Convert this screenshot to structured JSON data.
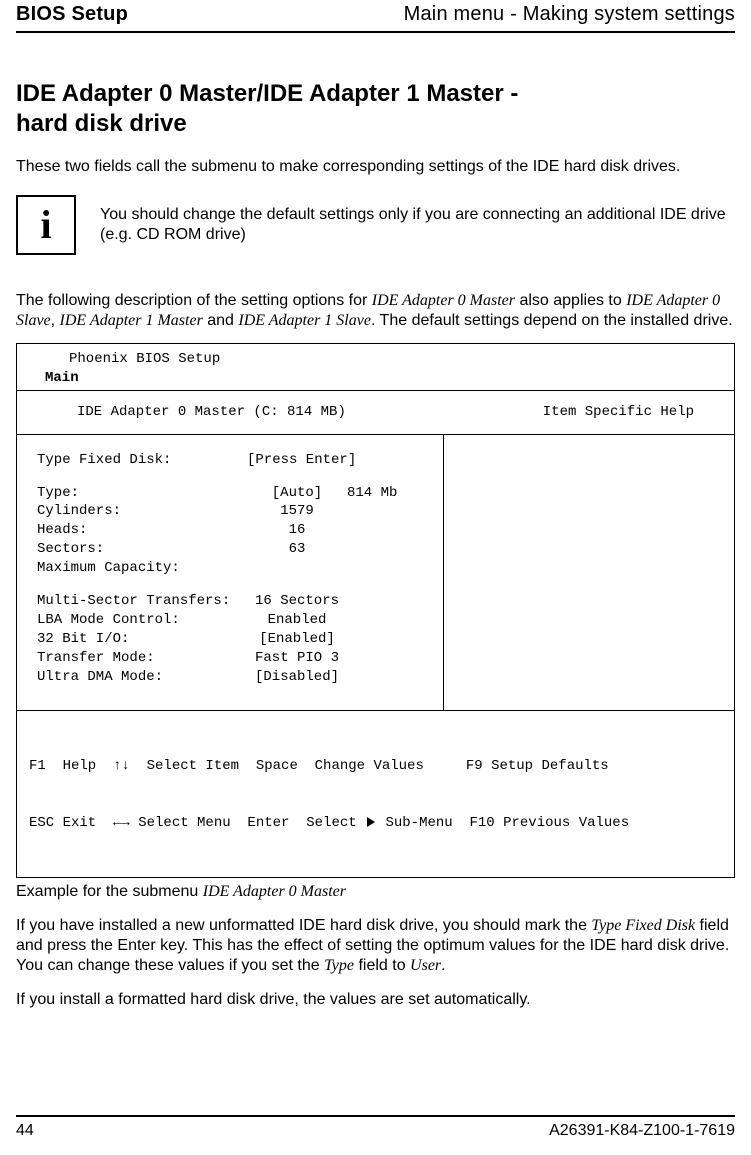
{
  "header": {
    "left": "BIOS Setup",
    "right": "Main menu - Making system settings"
  },
  "section_title_line1": "IDE Adapter 0 Master/IDE Adapter 1 Master -",
  "section_title_line2": "hard disk drive",
  "intro": "These two fields call the submenu to make corresponding settings of the IDE hard disk drives.",
  "info_icon_glyph": "i",
  "info_text": "You should change the default settings only if you are connecting an additional IDE drive (e.g. CD ROM drive)",
  "desc_pre": "The following description of the setting options for ",
  "desc_it1": "IDE Adapter 0 Master",
  "desc_mid1": " also applies to ",
  "desc_it2": "IDE Adapter 0 Slave",
  "desc_mid2": ", ",
  "desc_it3": "IDE Adapter 1 Master",
  "desc_mid3": " and ",
  "desc_it4": "IDE Adapter 1 Slave",
  "desc_post": ". The default settings depend on the installed drive.",
  "bios": {
    "setup_line": "Phoenix BIOS Setup",
    "main": "Main",
    "title_left": "IDE Adapter 0 Master (C: 814 MB)",
    "title_right": "Item Specific Help",
    "rows": {
      "tfd_k": "Type Fixed Disk:",
      "tfd_v": "[Press Enter]",
      "type_k": "Type:",
      "type_v": "[Auto]",
      "type_v2": "814 Mb",
      "cyl_k": "Cylinders:",
      "cyl_v": "1579",
      "heads_k": "Heads:",
      "heads_v": "16",
      "sect_k": "Sectors:",
      "sect_v": "63",
      "max_k": "Maximum Capacity:",
      "mst_k": "Multi-Sector Transfers:",
      "mst_v": "16 Sectors",
      "lba_k": "LBA Mode Control:",
      "lba_v": "Enabled",
      "io_k": "32 Bit I/O:",
      "io_v": "[Enabled]",
      "tm_k": "Transfer Mode:",
      "tm_v": "Fast PIO 3",
      "udma_k": "Ultra DMA Mode:",
      "udma_v": "[Disabled]"
    },
    "footer": {
      "f1": "F1  Help  ↑↓  Select Item  Space  Change Values     F9 Setup Defaults",
      "esc_pre": "ESC Exit  ←→ Select Menu  Enter  Select ",
      "esc_post": " Sub-Menu  F10 Previous Values"
    }
  },
  "caption_pre": "Example for the submenu ",
  "caption_it": "IDE Adapter 0 Master",
  "post1_a": "If you have installed a new unformatted IDE hard disk drive, you should mark the ",
  "post1_it1": "Type Fixed Disk",
  "post1_b": " field and press the Enter key. This has the effect of setting the optimum values for the IDE hard disk drive. You can change these values if you set the ",
  "post1_it2": "Type",
  "post1_c": " field to ",
  "post1_it3": "User",
  "post1_d": ".",
  "post2": "If you install a formatted hard disk drive, the values are set automatically.",
  "footer": {
    "page": "44",
    "doc_id": "A26391-K84-Z100-1-7619"
  }
}
